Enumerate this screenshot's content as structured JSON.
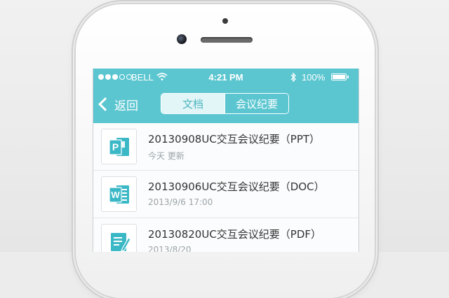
{
  "status_bar": {
    "carrier": "BELL",
    "time": "4:21 PM",
    "battery": "100%"
  },
  "nav": {
    "back_label": "返回",
    "tabs": [
      "文档",
      "会议纪要"
    ]
  },
  "files": [
    {
      "title": "20130908UC交互会议纪要（PPT）",
      "meta": "今天 更新",
      "icon": "powerpoint-file-icon"
    },
    {
      "title": "20130906UC交互会议纪要（DOC）",
      "meta": "2013/9/6    17:00",
      "icon": "word-file-icon"
    },
    {
      "title": "20130820UC交互会议纪要（PDF）",
      "meta": "2013/8/20",
      "icon": "pdf-file-icon"
    }
  ],
  "colors": {
    "header": "#5bc6d0",
    "powerpoint": "#3bb8c6",
    "word": "#3bb8c6",
    "pdf": "#3bb8c6"
  }
}
